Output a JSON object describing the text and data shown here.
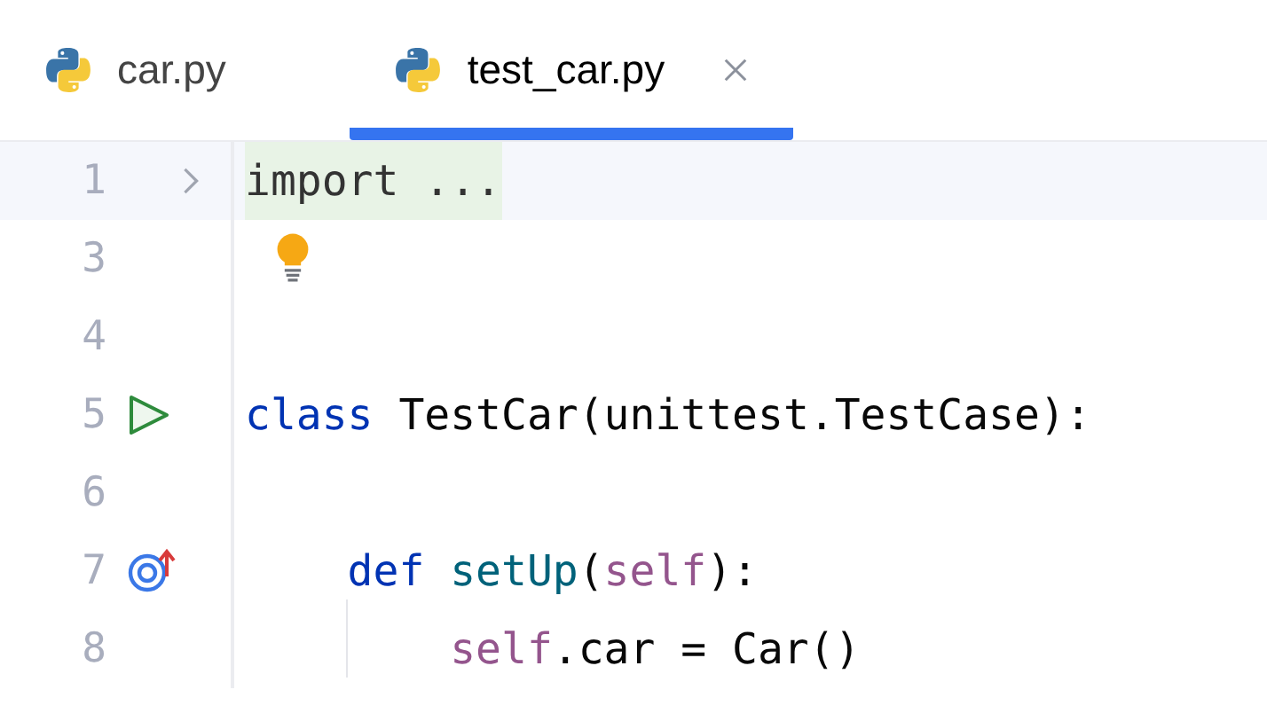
{
  "tabs": [
    {
      "label": "car.py",
      "selected": false,
      "closable": false
    },
    {
      "label": "test_car.py",
      "selected": true,
      "closable": true
    }
  ],
  "lines": [
    {
      "number": "1",
      "current": true,
      "gutter": {
        "kind": "fold"
      },
      "folded": true,
      "tokens": [
        {
          "kind": "plain",
          "text": "import ..."
        }
      ]
    },
    {
      "number": "3",
      "hint": {
        "kind": "bulb"
      }
    },
    {
      "number": "4"
    },
    {
      "number": "5",
      "gutter": {
        "kind": "run"
      },
      "tokens": [
        {
          "kind": "keyword",
          "text": "class"
        },
        {
          "kind": "plain",
          "text": " TestCar(unittest.TestCase):"
        }
      ]
    },
    {
      "number": "6"
    },
    {
      "number": "7",
      "gutter": {
        "kind": "override"
      },
      "tokens": [
        {
          "kind": "keyword",
          "text": "    def "
        },
        {
          "kind": "function",
          "text": "setUp"
        },
        {
          "kind": "plain",
          "text": "("
        },
        {
          "kind": "self",
          "text": "self"
        },
        {
          "kind": "plain",
          "text": "):"
        }
      ]
    },
    {
      "number": "8",
      "indent_guide": true,
      "tokens": [
        {
          "kind": "self",
          "text": "        self"
        },
        {
          "kind": "plain",
          "text": ".car = Car()"
        }
      ]
    }
  ]
}
